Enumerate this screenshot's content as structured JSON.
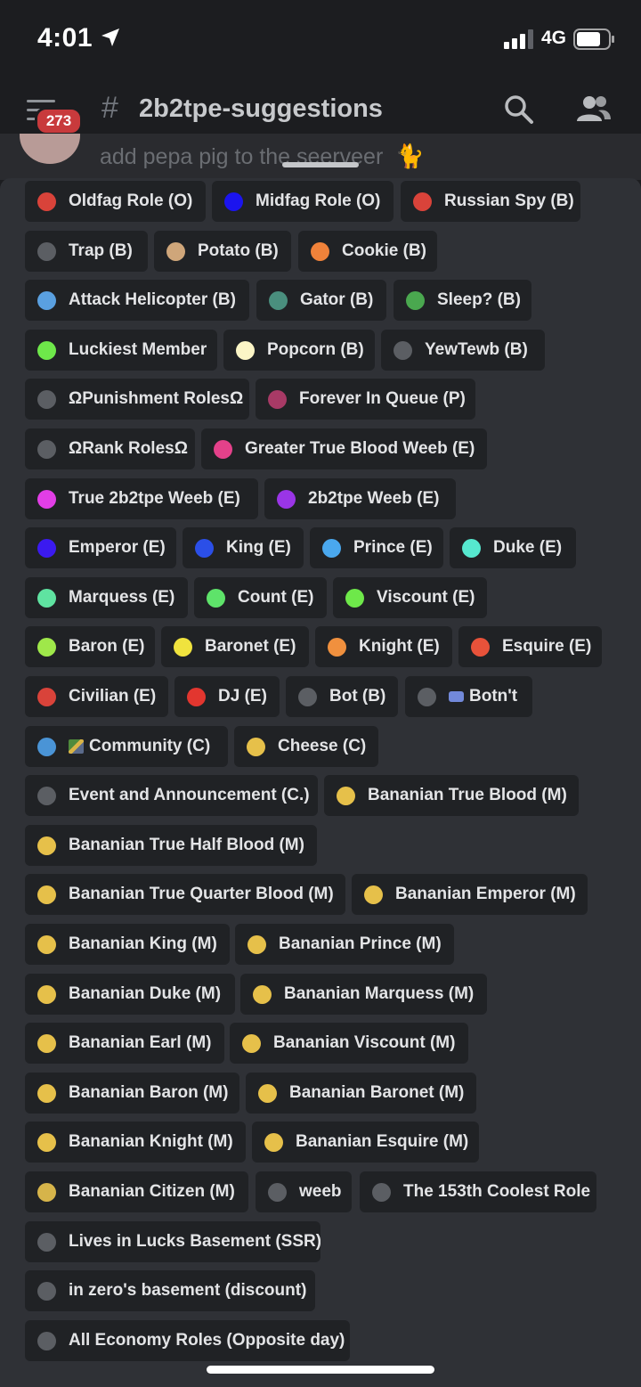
{
  "status_bar": {
    "time": "4:01",
    "network": "4G",
    "location_icon": "location-arrow-icon",
    "signal_icon": "cellular-signal-icon",
    "battery_icon": "battery-icon"
  },
  "header": {
    "menu_icon": "hamburger-menu-icon",
    "badge_count": "273",
    "hash": "#",
    "channel_name": "2b2tpe-suggestions",
    "search_icon": "search-icon",
    "members_icon": "members-icon"
  },
  "message": {
    "text": "add pepa pig to the seerveer",
    "emoji_icon": "cat-emoji-icon"
  },
  "colors": {
    "sheet_bg": "#2f3136",
    "pill_bg": "#202225",
    "header_bg": "#1c1d20",
    "badge": "#c83a3c"
  },
  "roles": [
    {
      "label": "Oldfag Role (O)",
      "color": "#d9433a"
    },
    {
      "label": "Midfag Role (O)",
      "color": "#1b14ee"
    },
    {
      "label": "Russian Spy (B)",
      "color": "#d9433a"
    },
    {
      "label": "Trap (B)",
      "color": "#5b5e63"
    },
    {
      "label": "Potato (B)",
      "color": "#cfa67a"
    },
    {
      "label": "Cookie (B)",
      "color": "#f0823a"
    },
    {
      "label": "Attack Helicopter (B)",
      "color": "#5aa0e0"
    },
    {
      "label": "Gator (B)",
      "color": "#4a8f7e"
    },
    {
      "label": "Sleep? (B)",
      "color": "#4aa84f"
    },
    {
      "label": "Luckiest Member",
      "color": "#6ee84a"
    },
    {
      "label": "Popcorn (B)",
      "color": "#fbf5c6"
    },
    {
      "label": "YewTewb (B)",
      "color": "#5b5e63"
    },
    {
      "label": "ΩPunishment RolesΩ",
      "color": "#5b5e63"
    },
    {
      "label": "Forever In Queue (P)",
      "color": "#a83a66"
    },
    {
      "label": "ΩRank RolesΩ",
      "color": "#5b5e63"
    },
    {
      "label": "Greater True Blood Weeb (E)",
      "color": "#e4418a"
    },
    {
      "label": "True 2b2tpe Weeb (E)",
      "color": "#e23ee6"
    },
    {
      "label": "2b2tpe Weeb (E)",
      "color": "#9a35e6"
    },
    {
      "label": "Emperor (E)",
      "color": "#3b1af0"
    },
    {
      "label": "King (E)",
      "color": "#2b4fe8"
    },
    {
      "label": "Prince (E)",
      "color": "#4aa8ee"
    },
    {
      "label": "Duke (E)",
      "color": "#56e8cf"
    },
    {
      "label": "Marquess (E)",
      "color": "#5fe3a1"
    },
    {
      "label": "Count (E)",
      "color": "#5ee36a"
    },
    {
      "label": "Viscount (E)",
      "color": "#6ee84a"
    },
    {
      "label": "Baron (E)",
      "color": "#9fe84a"
    },
    {
      "label": "Baronet (E)",
      "color": "#f0e33e"
    },
    {
      "label": "Knight (E)",
      "color": "#f0903e"
    },
    {
      "label": "Esquire (E)",
      "color": "#e8523a"
    },
    {
      "label": "Civilian (E)",
      "color": "#d9433a"
    },
    {
      "label": "DJ (E)",
      "color": "#e2362f"
    },
    {
      "label": "Bot (B)",
      "color": "#5b5e63"
    },
    {
      "label": "Botn't",
      "color": "#5b5e63"
    },
    {
      "label": "Community (C)",
      "color": "#4a94d6"
    },
    {
      "label": "Cheese (C)",
      "color": "#e6c04a"
    },
    {
      "label": "Event and Announcement (C.)",
      "color": "#5b5e63"
    },
    {
      "label": "Bananian True Blood (M)",
      "color": "#e6c04a"
    },
    {
      "label": "Bananian True Half Blood (M)",
      "color": "#e6c04a"
    },
    {
      "label": "Bananian True Quarter Blood (M)",
      "color": "#e6c04a"
    },
    {
      "label": "Bananian Emperor (M)",
      "color": "#e6c04a"
    },
    {
      "label": "Bananian King (M)",
      "color": "#e6c04a"
    },
    {
      "label": "Bananian Prince (M)",
      "color": "#e6c04a"
    },
    {
      "label": "Bananian Duke (M)",
      "color": "#e6c04a"
    },
    {
      "label": "Bananian Marquess (M)",
      "color": "#e6c04a"
    },
    {
      "label": "Bananian Earl (M)",
      "color": "#e6c04a"
    },
    {
      "label": "Bananian Viscount (M)",
      "color": "#e6c04a"
    },
    {
      "label": "Bananian Baron (M)",
      "color": "#e6c04a"
    },
    {
      "label": "Bananian Baronet (M)",
      "color": "#e6c04a"
    },
    {
      "label": "Bananian Knight (M)",
      "color": "#e6c04a"
    },
    {
      "label": "Bananian Esquire (M)",
      "color": "#e6c04a"
    },
    {
      "label": "Bananian Citizen (M)",
      "color": "#d6b44a"
    },
    {
      "label": "weeb",
      "color": "#5b5e63"
    },
    {
      "label": "The 153th Coolest Role",
      "color": "#5b5e63"
    },
    {
      "label": "Lives in Lucks Basement (SSR)",
      "color": "#5b5e63"
    },
    {
      "label": "in zero's basement (discount)",
      "color": "#5b5e63"
    },
    {
      "label": "All Economy Roles (Opposite day)",
      "color": "#5b5e63"
    }
  ]
}
